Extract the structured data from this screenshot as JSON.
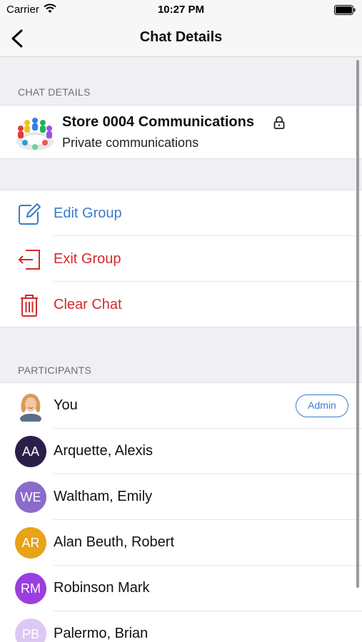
{
  "status": {
    "carrier": "Carrier",
    "time": "10:27 PM"
  },
  "nav": {
    "title": "Chat Details",
    "back_icon": "chevron-left-icon"
  },
  "chat_details": {
    "header": "CHAT DETAILS",
    "name": "Store 0004 Communications",
    "description": "Private communications",
    "lock_icon": "lock-icon"
  },
  "actions": [
    {
      "label": "Edit Group",
      "icon": "edit-icon",
      "color": "#3a7bc8"
    },
    {
      "label": "Exit Group",
      "icon": "exit-icon",
      "color": "#d42a2a"
    },
    {
      "label": "Clear Chat",
      "icon": "trash-icon",
      "color": "#d42a2a"
    }
  ],
  "participants": {
    "header": "PARTICIPANTS",
    "admin_label": "Admin",
    "items": [
      {
        "name": "You",
        "initials": "",
        "color": "#e8a07a",
        "photo": true
      },
      {
        "name": "Arquette, Alexis",
        "initials": "AA",
        "color": "#2b1f4a"
      },
      {
        "name": "Waltham, Emily",
        "initials": "WE",
        "color": "#8a6bc9"
      },
      {
        "name": "Alan Beuth, Robert",
        "initials": "AR",
        "color": "#e8a317"
      },
      {
        "name": "Robinson Mark",
        "initials": "RM",
        "color": "#9b3ee0"
      },
      {
        "name": "Palermo, Brian",
        "initials": "PB",
        "color": "#dcc8f2"
      }
    ]
  }
}
